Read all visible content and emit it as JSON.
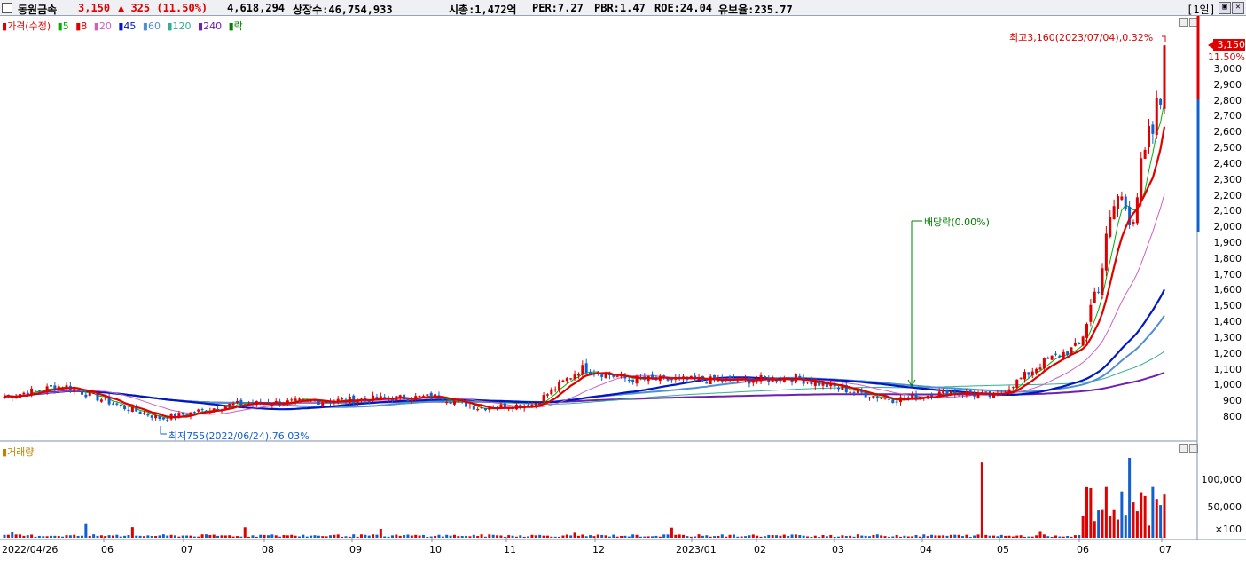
{
  "header": {
    "name": "동원금속",
    "price": "3,150",
    "change": "▲ 325 (11.50%)",
    "volume": "4,618,294",
    "shares": "상장수:46,754,933",
    "mktcap": "시총:1,472억",
    "per": "PER:7.27",
    "pbr": "PBR:1.47",
    "roe": "ROE:24.04",
    "reserve": "유보율:235.77",
    "period": "[1일]"
  },
  "price_legend": {
    "price": "가격(수정)",
    "ma5": "5",
    "ma8": "8",
    "ma20": "20",
    "ma45": "45",
    "ma60": "60",
    "ma120": "120",
    "ma240": "240",
    "ex": "락"
  },
  "volume_legend": {
    "label": "거래량"
  },
  "annotations": {
    "high": "최고3,160(2023/07/04),0.32%",
    "low": "최저755(2022/06/24),76.03%",
    "dividend": "배당락(0.00%)",
    "current_price": "3,150",
    "current_pct": "11.50%"
  },
  "price_axis": [
    "3,000",
    "2,900",
    "2,800",
    "2,700",
    "2,600",
    "2,500",
    "2,400",
    "2,300",
    "2,200",
    "2,100",
    "2,000",
    "1,900",
    "1,800",
    "1,700",
    "1,600",
    "1,500",
    "1,400",
    "1,300",
    "1,200",
    "1,100",
    "1,000",
    "900",
    "800"
  ],
  "volume_axis": [
    "100,000",
    "50,000",
    "×100"
  ],
  "x_axis": [
    "2022/04/26",
    "06",
    "07",
    "08",
    "09",
    "10",
    "11",
    "12",
    "2023/01",
    "02",
    "03",
    "04",
    "05",
    "06",
    "07"
  ],
  "colors": {
    "up": "#e00000",
    "down": "#1060d0",
    "ma5": "#00b000",
    "ma8": "#e00000",
    "ma20": "#d060c0",
    "ma45": "#0018c0",
    "ma60": "#5090d0",
    "ma120": "#30b090",
    "ma240": "#7020b0"
  },
  "chart_data": {
    "type": "candlestick",
    "x_range": [
      "2022/04/26",
      "2023/07/04"
    ],
    "ylim": [
      750,
      3200
    ],
    "anchors": [
      {
        "x": "2022/04/26",
        "y": 930
      },
      {
        "x": "2022/05/18",
        "y": 1000
      },
      {
        "x": "2022/06/10",
        "y": 860
      },
      {
        "x": "2022/06/24",
        "y": 790
      },
      {
        "x": "2022/07/20",
        "y": 880
      },
      {
        "x": "2022/08/20",
        "y": 900
      },
      {
        "x": "2022/10/05",
        "y": 930
      },
      {
        "x": "2022/10/20",
        "y": 860
      },
      {
        "x": "2022/11/10",
        "y": 880
      },
      {
        "x": "2022/11/28",
        "y": 1110
      },
      {
        "x": "2022/12/15",
        "y": 1040
      },
      {
        "x": "2023/01/25",
        "y": 1030
      },
      {
        "x": "2023/02/15",
        "y": 1050
      },
      {
        "x": "2023/03/10",
        "y": 960
      },
      {
        "x": "2023/03/25",
        "y": 910
      },
      {
        "x": "2023/04/15",
        "y": 960
      },
      {
        "x": "2023/05/02",
        "y": 930
      },
      {
        "x": "2023/05/20",
        "y": 1150
      },
      {
        "x": "2023/06/02",
        "y": 1250
      },
      {
        "x": "2023/06/10",
        "y": 1700
      },
      {
        "x": "2023/06/16",
        "y": 2200
      },
      {
        "x": "2023/06/22",
        "y": 2100
      },
      {
        "x": "2023/06/28",
        "y": 2500
      },
      {
        "x": "2023/07/03",
        "y": 2825
      },
      {
        "x": "2023/07/04",
        "y": 3150
      }
    ],
    "volume_max": 140000
  }
}
